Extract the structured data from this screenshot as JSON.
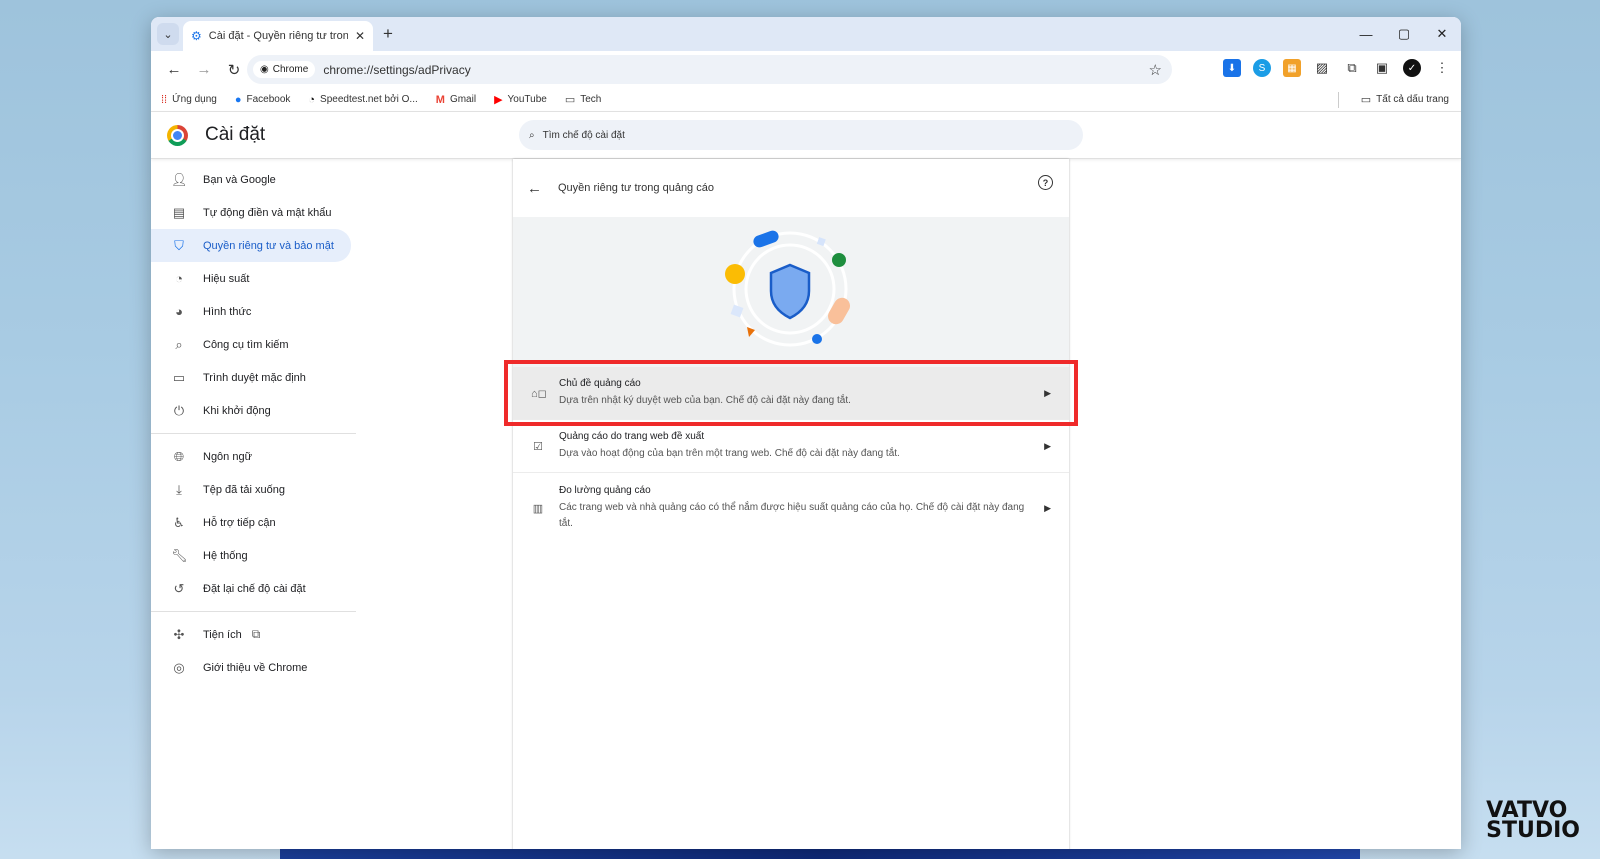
{
  "tab": {
    "title": "Cài đặt - Quyền riêng tư trong q",
    "close": "✕",
    "new_tab": "+"
  },
  "window_controls": [
    "—",
    "▢",
    "✕"
  ],
  "toolbar": {
    "chip_label": "Chrome",
    "url": "chrome://settings/adPrivacy"
  },
  "bookmarks": {
    "items": [
      {
        "label": "Ứng dụng",
        "icon": "apps-grid-icon"
      },
      {
        "label": "Facebook",
        "icon": "facebook-icon"
      },
      {
        "label": "Speedtest.net bởi O...",
        "icon": "speedtest-icon"
      },
      {
        "label": "Gmail",
        "icon": "gmail-icon"
      },
      {
        "label": "YouTube",
        "icon": "youtube-icon"
      },
      {
        "label": "Tech",
        "icon": "folder-icon"
      }
    ],
    "all_label": "Tất cả dấu trang"
  },
  "settings": {
    "title": "Cài đặt",
    "search_placeholder": "Tìm chế độ cài đặt"
  },
  "sidebar": {
    "items": [
      {
        "label": "Bạn và Google"
      },
      {
        "label": "Tự động điền và mật khẩu"
      },
      {
        "label": "Quyền riêng tư và bảo mật"
      },
      {
        "label": "Hiệu suất"
      },
      {
        "label": "Hình thức"
      },
      {
        "label": "Công cụ tìm kiếm"
      },
      {
        "label": "Trình duyệt mặc định"
      },
      {
        "label": "Khi khởi động"
      },
      {
        "label": "Ngôn ngữ"
      },
      {
        "label": "Tệp đã tải xuống"
      },
      {
        "label": "Hỗ trợ tiếp cận"
      },
      {
        "label": "Hệ thống"
      },
      {
        "label": "Đặt lại chế độ cài đặt"
      },
      {
        "label": "Tiện ích"
      },
      {
        "label": "Giới thiệu về Chrome"
      }
    ]
  },
  "main": {
    "header_title": "Quyền riêng tư trong quảng cáo",
    "help": "?",
    "rows": [
      {
        "title": "Chủ đề quảng cáo",
        "desc": "Dựa trên nhật ký duyệt web của bạn. Chế độ cài đặt này đang tắt."
      },
      {
        "title": "Quảng cáo do trang web đề xuất",
        "desc": "Dựa vào hoạt động của bạn trên một trang web. Chế độ cài đặt này đang tắt."
      },
      {
        "title": "Đo lường quảng cáo",
        "desc": "Các trang web và nhà quảng cáo có thể nắm được hiệu suất quảng cáo của họ. Chế độ cài đặt này đang tắt."
      }
    ]
  },
  "watermark": {
    "line1": "VATVO",
    "line2": "STUDIO"
  },
  "colors": {
    "accent": "#1a73e8",
    "active_bg": "#e6eefb",
    "highlight_border": "#ef2a2a"
  }
}
